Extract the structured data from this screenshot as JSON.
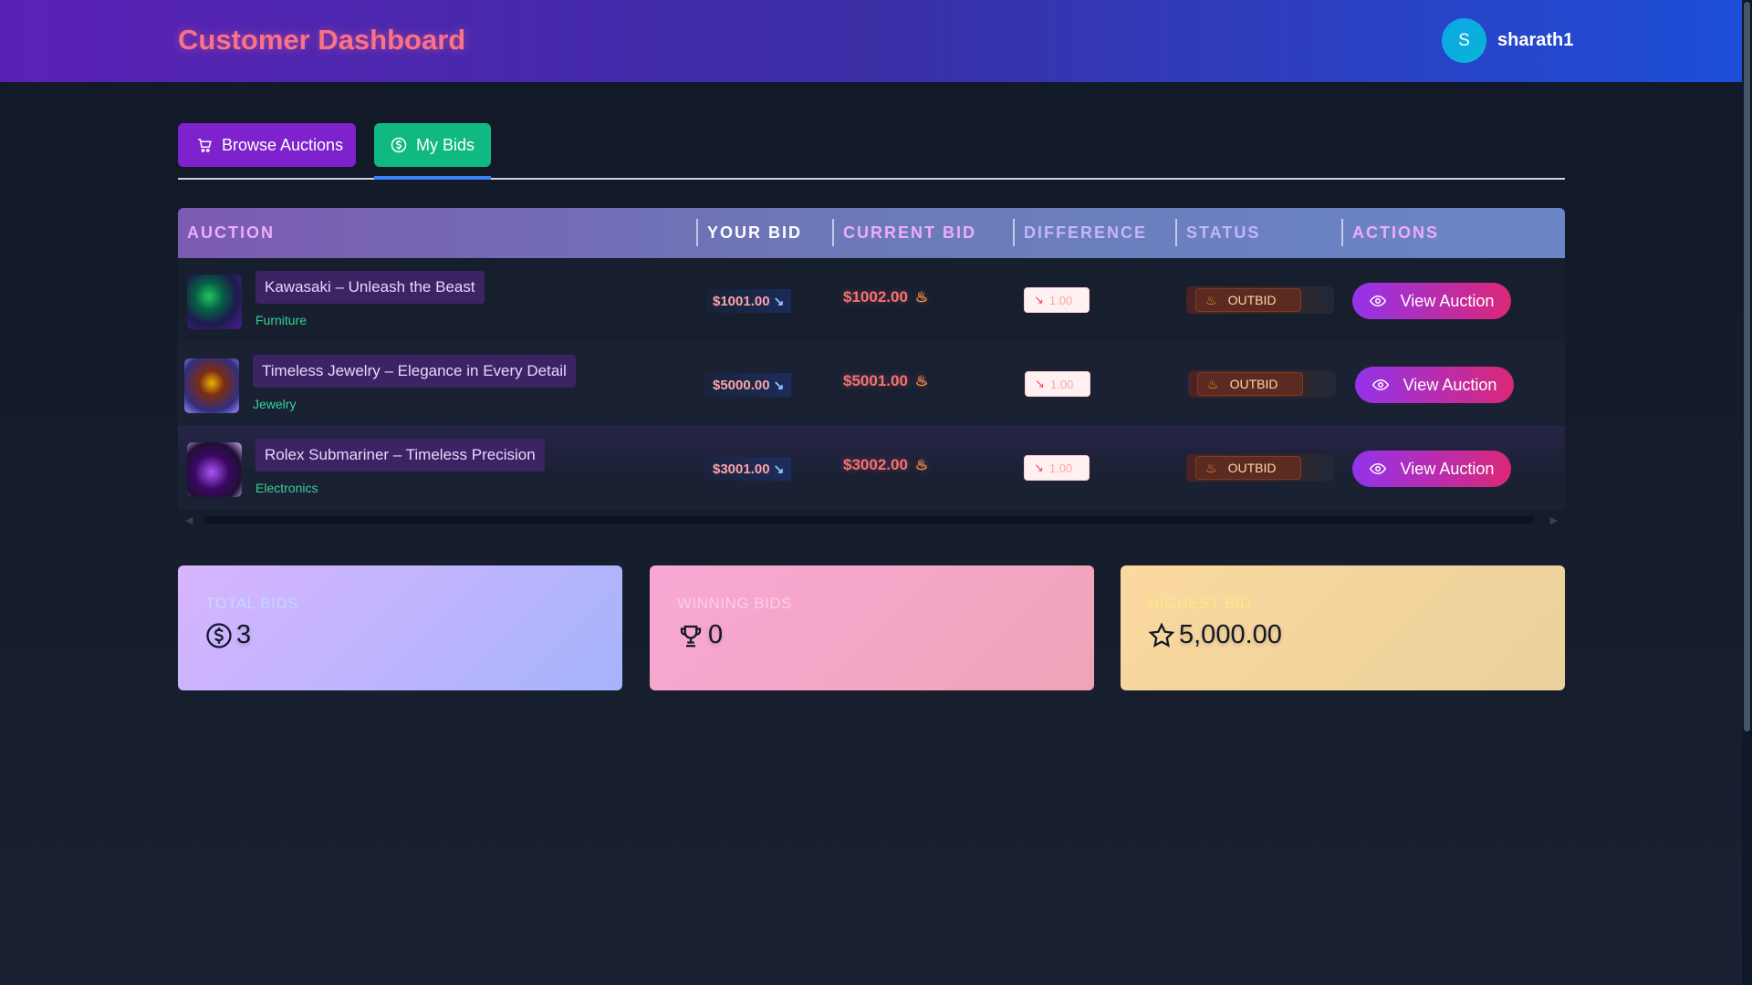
{
  "header": {
    "title": "Customer Dashboard",
    "user": {
      "initial": "S",
      "name": "sharath1"
    }
  },
  "tabs": [
    {
      "label": "Browse Auctions",
      "icon": "cart-icon",
      "active": false
    },
    {
      "label": "My Bids",
      "icon": "dollar-circle-icon",
      "active": true
    }
  ],
  "table": {
    "columns": [
      "AUCTION",
      "YOUR BID",
      "CURRENT BID",
      "DIFFERENCE",
      "STATUS",
      "ACTIONS"
    ],
    "rows": [
      {
        "title": "Kawasaki – Unleash the Beast",
        "category": "Furniture",
        "your_bid": "$1001.00",
        "current_bid": "$1002.00",
        "difference": "1.00",
        "status": "OUTBID",
        "action": "View Auction"
      },
      {
        "title": "Timeless Jewelry – Elegance in Every Detail",
        "category": "Jewelry",
        "your_bid": "$5000.00",
        "current_bid": "$5001.00",
        "difference": "1.00",
        "status": "OUTBID",
        "action": "View Auction"
      },
      {
        "title": "Rolex Submariner – Timeless Precision",
        "category": "Electronics",
        "your_bid": "$3001.00",
        "current_bid": "$3002.00",
        "difference": "1.00",
        "status": "OUTBID",
        "action": "View Auction"
      }
    ]
  },
  "stats": {
    "total_bids": {
      "label": "TOTAL BIDS",
      "value": "3"
    },
    "winning_bids": {
      "label": "WINNING BIDS",
      "value": "0"
    },
    "highest_bid": {
      "label": "HIGHEST BID",
      "value": "5,000.00"
    }
  },
  "colors": {
    "accent_purple": "#7e22ce",
    "accent_green": "#10b981",
    "outbid": "#fb923c"
  }
}
